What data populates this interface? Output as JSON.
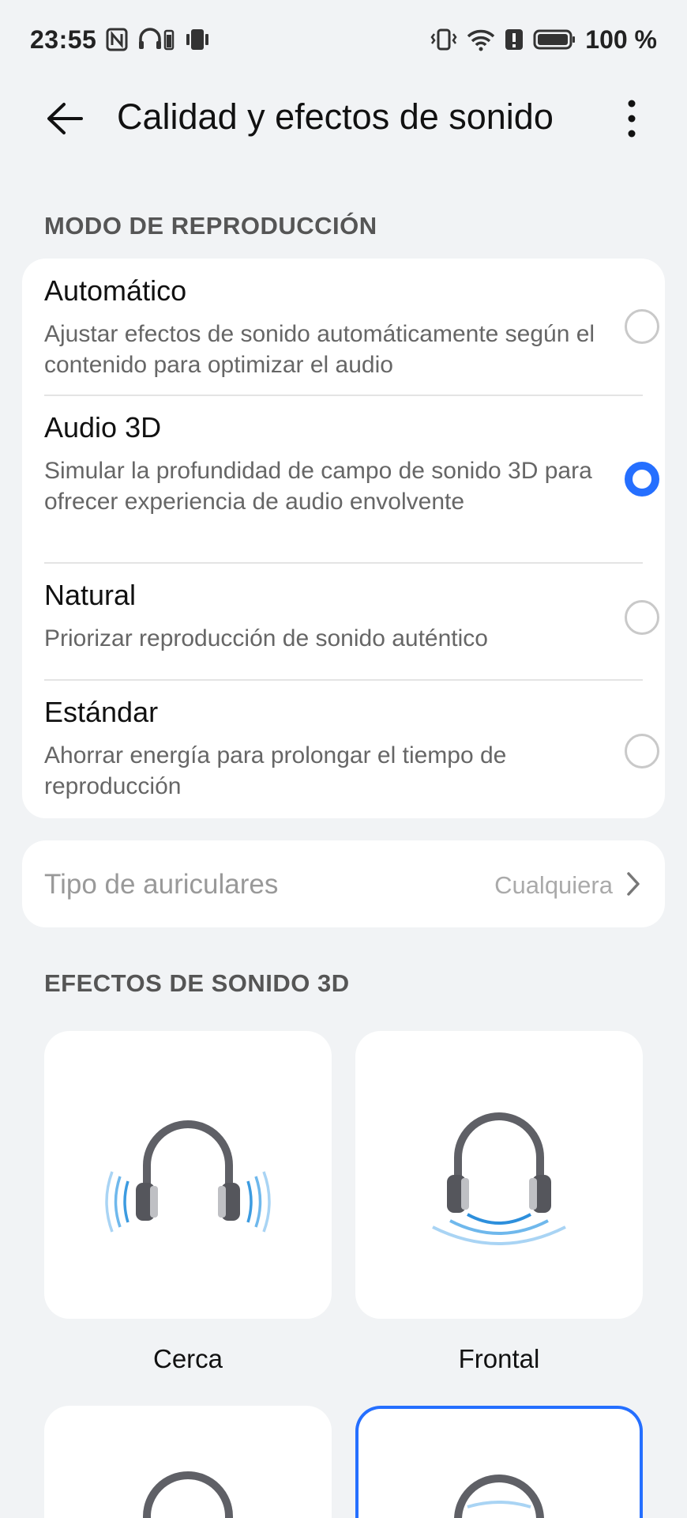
{
  "status_bar": {
    "time": "23:55",
    "battery": "100 %",
    "left_icons": [
      "nfc-icon",
      "headphones-battery-icon",
      "vibrate-icon"
    ],
    "right_icons": [
      "vibrate-mode-icon",
      "wifi-icon",
      "alert-icon",
      "battery-icon"
    ]
  },
  "app_bar": {
    "title": "Calidad y efectos de sonido",
    "back_icon": "arrow-left-icon",
    "more_icon": "more-vertical-icon"
  },
  "playback_mode": {
    "header": "MODO DE REPRODUCCIÓN",
    "options": [
      {
        "title": "Automático",
        "description": "Ajustar efectos de sonido automáticamente según el contenido para optimizar el audio",
        "selected": false
      },
      {
        "title": "Audio 3D",
        "description": "Simular la profundidad de campo de sonido 3D para ofrecer experiencia de audio envolvente",
        "selected": true
      },
      {
        "title": "Natural",
        "description": "Priorizar reproducción de sonido auténtico",
        "selected": false
      },
      {
        "title": "Estándar",
        "description": "Ahorrar energía para prolongar el tiempo de reproducción",
        "selected": false
      }
    ]
  },
  "headphone_type": {
    "label": "Tipo de auriculares",
    "value": "Cualquiera",
    "chevron_icon": "chevron-right-icon"
  },
  "effects_3d": {
    "header": "EFECTOS DE SONIDO 3D",
    "tiles": [
      {
        "label": "Cerca",
        "icon": "headphones-near-icon",
        "selected": false
      },
      {
        "label": "Frontal",
        "icon": "headphones-front-icon",
        "selected": false
      },
      {
        "label": "",
        "icon": "headphones-icon",
        "selected": false
      },
      {
        "label": "",
        "icon": "headphones-icon",
        "selected": true
      }
    ]
  },
  "colors": {
    "accent": "#256fff",
    "background": "#f1f3f5",
    "card": "#ffffff",
    "wave_blue": "#5aaee8"
  }
}
